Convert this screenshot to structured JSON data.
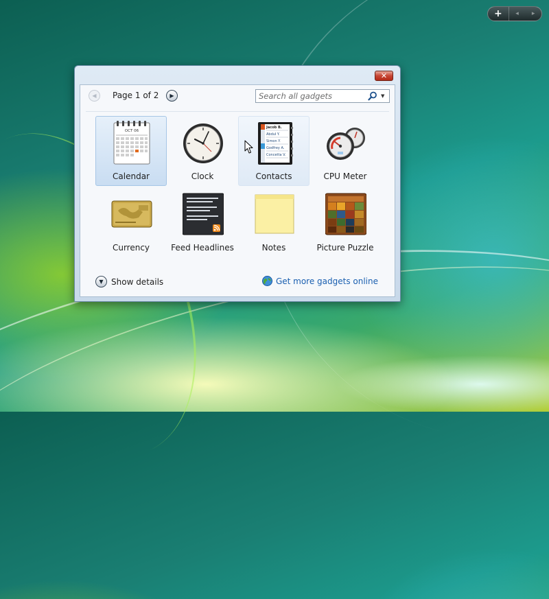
{
  "sidebar_control": {
    "add_label": "+",
    "prev_label": "◂",
    "next_label": "▸"
  },
  "window": {
    "close_label": "✕"
  },
  "toolbar": {
    "page_label": "Page 1 of 2",
    "search_placeholder": "Search all gadgets",
    "search_value": ""
  },
  "gadgets": [
    {
      "label": "Calendar",
      "state": "selected",
      "icon": "calendar-icon"
    },
    {
      "label": "Clock",
      "state": "normal",
      "icon": "clock-icon"
    },
    {
      "label": "Contacts",
      "state": "hover",
      "icon": "contacts-icon"
    },
    {
      "label": "CPU Meter",
      "state": "normal",
      "icon": "cpu-meter-icon"
    },
    {
      "label": "Currency",
      "state": "normal",
      "icon": "currency-icon"
    },
    {
      "label": "Feed Headlines",
      "state": "normal",
      "icon": "feed-headlines-icon"
    },
    {
      "label": "Notes",
      "state": "normal",
      "icon": "notes-icon"
    },
    {
      "label": "Picture Puzzle",
      "state": "normal",
      "icon": "picture-puzzle-icon"
    }
  ],
  "calendar_icon": {
    "month": "OCT 06",
    "highlight_day": "25"
  },
  "contacts_icon": {
    "names": [
      "Jacob B.",
      "Abdul Y.",
      "Simon Y.",
      "Godfrey A.",
      "Concetta V."
    ]
  },
  "footer": {
    "details_label": "Show details",
    "online_label": "Get more gadgets online"
  },
  "colors": {
    "accent_link": "#1a5fb0",
    "selection_border": "#a6c6e6",
    "close_red": "#c74634"
  }
}
